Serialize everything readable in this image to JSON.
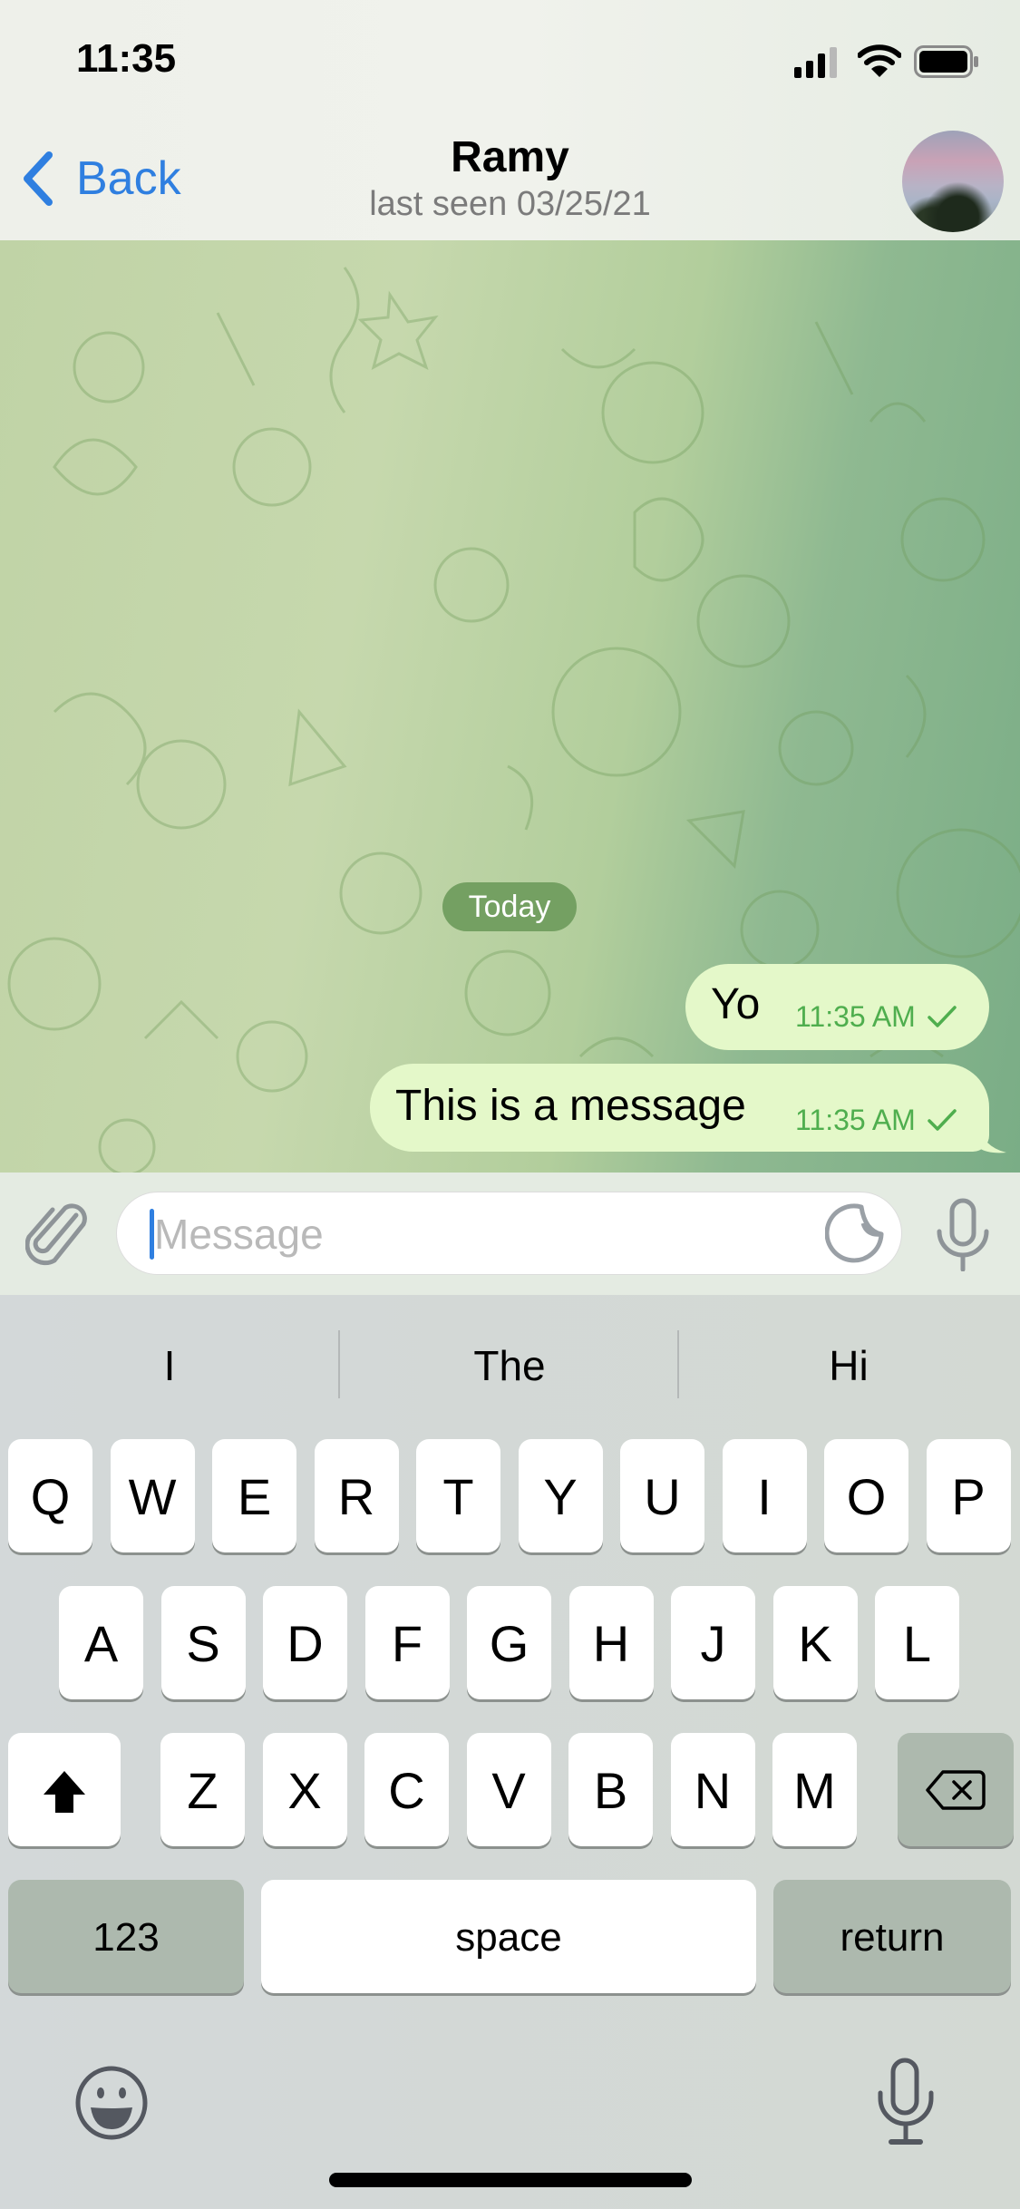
{
  "status_bar": {
    "time": "11:35",
    "icons": [
      "cellular-signal-icon",
      "wifi-icon",
      "battery-icon"
    ]
  },
  "nav": {
    "back_label": "Back",
    "title": "Ramy",
    "subtitle": "last seen 03/25/21",
    "avatar": "contact-avatar"
  },
  "chat": {
    "date_separator": "Today",
    "messages": [
      {
        "text": "Yo",
        "time": "11:35 AM",
        "status": "sent",
        "outgoing": true
      },
      {
        "text": "This is a message",
        "time": "11:35 AM",
        "status": "sent",
        "outgoing": true
      }
    ]
  },
  "composer": {
    "placeholder": "Message",
    "value": "",
    "icons": [
      "attach-icon",
      "sticker-icon",
      "microphone-icon"
    ]
  },
  "keyboard": {
    "predictions": [
      "I",
      "The",
      "Hi"
    ],
    "rows": [
      [
        "Q",
        "W",
        "E",
        "R",
        "T",
        "Y",
        "U",
        "I",
        "O",
        "P"
      ],
      [
        "A",
        "S",
        "D",
        "F",
        "G",
        "H",
        "J",
        "K",
        "L"
      ],
      [
        "Z",
        "X",
        "C",
        "V",
        "B",
        "N",
        "M"
      ]
    ],
    "numbers_label": "123",
    "space_label": "space",
    "return_label": "return"
  },
  "colors": {
    "accent": "#2f7fe0",
    "bubble_outgoing": "#e4f8c9",
    "timestamp": "#4fae4e",
    "date_pill": "#74a062"
  }
}
